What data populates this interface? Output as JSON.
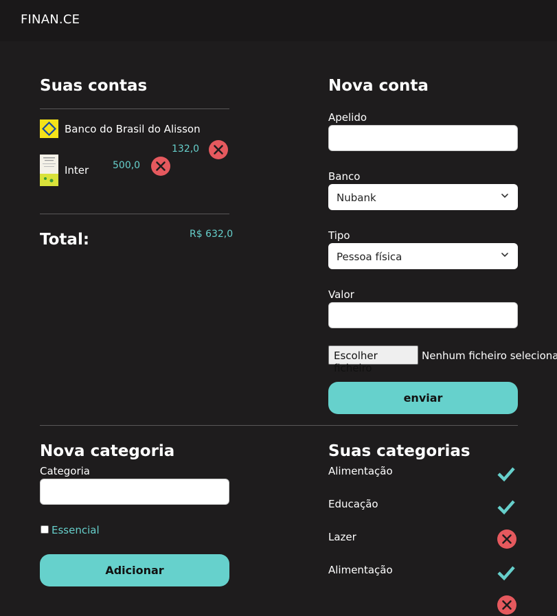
{
  "app": {
    "brand": "FINAN.CE"
  },
  "accounts": {
    "title": "Suas contas",
    "items": [
      {
        "name": "Banco do Brasil do Alisson",
        "value": "132,0"
      },
      {
        "name": "Inter",
        "value": "500,0"
      }
    ],
    "total_label": "Total:",
    "total_value": "R$ 632,0"
  },
  "new_account": {
    "title": "Nova conta",
    "nickname_label": "Apelido",
    "bank_label": "Banco",
    "bank_value": "Nubank",
    "type_label": "Tipo",
    "type_value": "Pessoa física",
    "value_label": "Valor",
    "file_button": "Escolher ficheiro",
    "file_status": "Nenhum ficheiro selecionado",
    "submit": "enviar"
  },
  "new_category": {
    "title": "Nova categoria",
    "category_label": "Categoria",
    "essential_label": "Essencial",
    "add_button": "Adicionar"
  },
  "categories": {
    "title": "Suas categorias",
    "items": [
      {
        "name": "Alimentação",
        "essential": true
      },
      {
        "name": "Educação",
        "essential": true
      },
      {
        "name": "Lazer",
        "essential": false
      },
      {
        "name": "Alimentação",
        "essential": true
      },
      {
        "name": "",
        "essential": false
      }
    ]
  },
  "colors": {
    "accent": "#66d1cc",
    "danger": "#e5595e",
    "background": "#1e1c1d"
  }
}
